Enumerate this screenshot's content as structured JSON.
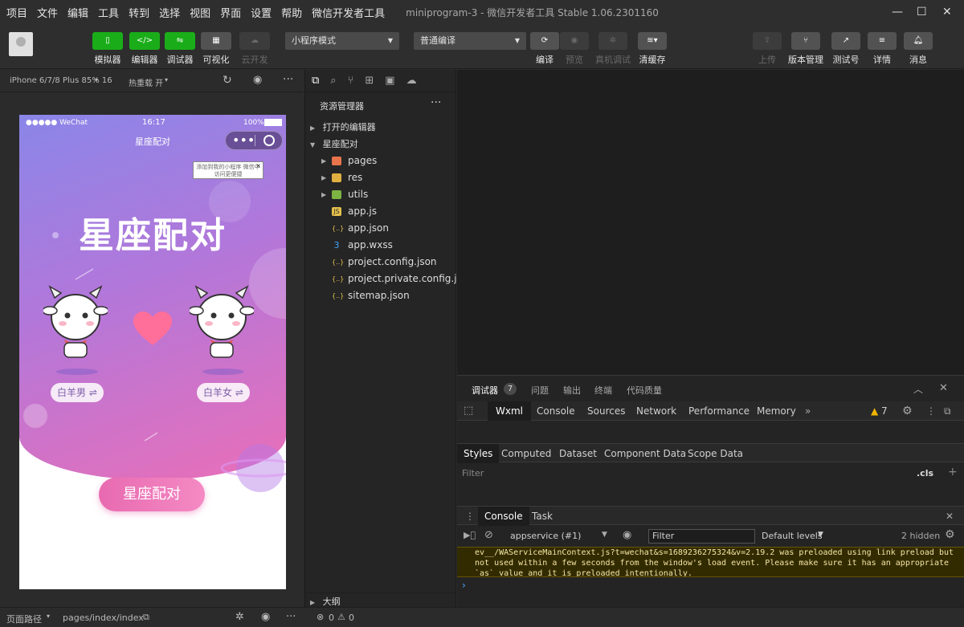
{
  "menu": {
    "items": [
      "项目",
      "文件",
      "编辑",
      "工具",
      "转到",
      "选择",
      "视图",
      "界面",
      "设置",
      "帮助",
      "微信开发者工具"
    ],
    "window_title": "miniprogram-3 - 微信开发者工具 Stable 1.06.2301160"
  },
  "toolbar": {
    "left": [
      {
        "label": "模拟器",
        "glyph": "▯"
      },
      {
        "label": "编辑器",
        "glyph": "</>"
      },
      {
        "label": "调试器",
        "glyph": "⇋"
      },
      {
        "label": "可视化",
        "glyph": "▦"
      },
      {
        "label": "云开发",
        "glyph": "☁"
      }
    ],
    "mode_select": "小程序模式",
    "compile_select": "普通编译",
    "mid": [
      {
        "label": "编译"
      },
      {
        "label": "预览"
      },
      {
        "label": "真机调试"
      },
      {
        "label": "清缓存"
      }
    ],
    "right": [
      {
        "label": "上传"
      },
      {
        "label": "版本管理"
      },
      {
        "label": "测试号"
      },
      {
        "label": "详情"
      },
      {
        "label": "消息"
      }
    ]
  },
  "simulator": {
    "device": "iPhone 6/7/8 Plus 85% 16",
    "hot_reload": "热重载 开",
    "status_left": "●●●●● WeChat",
    "status_time": "16:17",
    "status_battery": "100%",
    "nav_title": "星座配对",
    "tooltip": "添加到我的小程序 微信中访问更便捷",
    "big_title": "星座配对",
    "left_sign": "白羊男 ⇌",
    "right_sign": "白羊女 ⇌",
    "match_button": "星座配对"
  },
  "explorer": {
    "title": "资源管理器",
    "open_editors": "打开的编辑器",
    "project": "星座配对",
    "files": [
      {
        "name": "pages",
        "type": "folder",
        "color": "#e8744b"
      },
      {
        "name": "res",
        "type": "folder",
        "color": "#e0b040"
      },
      {
        "name": "utils",
        "type": "folder",
        "color": "#7cb342"
      },
      {
        "name": "app.js",
        "type": "js",
        "color": "#e5c04b"
      },
      {
        "name": "app.json",
        "type": "json",
        "color": "#e5c04b"
      },
      {
        "name": "app.wxss",
        "type": "css",
        "color": "#42a5f5"
      },
      {
        "name": "project.config.json",
        "type": "json",
        "color": "#e5c04b"
      },
      {
        "name": "project.private.config.js...",
        "type": "json",
        "color": "#e5c04b"
      },
      {
        "name": "sitemap.json",
        "type": "json",
        "color": "#e5c04b"
      }
    ],
    "outline": "大纲"
  },
  "devtools": {
    "top_tabs": [
      {
        "label": "调试器",
        "badge": "7"
      },
      {
        "label": "问题"
      },
      {
        "label": "输出"
      },
      {
        "label": "终端"
      },
      {
        "label": "代码质量"
      }
    ],
    "panel_tabs": [
      "Wxml",
      "Console",
      "Sources",
      "Network",
      "Performance",
      "Memory"
    ],
    "warn_count": "7",
    "style_tabs": [
      "Styles",
      "Computed",
      "Dataset",
      "Component Data",
      "Scope Data"
    ],
    "filter_placeholder": "Filter",
    "cls": ".cls",
    "console_tabs": [
      "Console",
      "Task"
    ],
    "context": "appservice (#1)",
    "console_filter": "Filter",
    "levels": "Default levels",
    "hidden": "2 hidden",
    "warning_text": "ev__/WAServiceMainContext.js?t=wechat&s=1689236275324&v=2.19.2 was preloaded using link preload but not used within a few seconds from the window's load event. Please make sure it has an appropriate `as` value and it is preloaded intentionally."
  },
  "bottom": {
    "path_label": "页面路径",
    "path": "pages/index/index",
    "errors": "0",
    "warnings": "0"
  }
}
